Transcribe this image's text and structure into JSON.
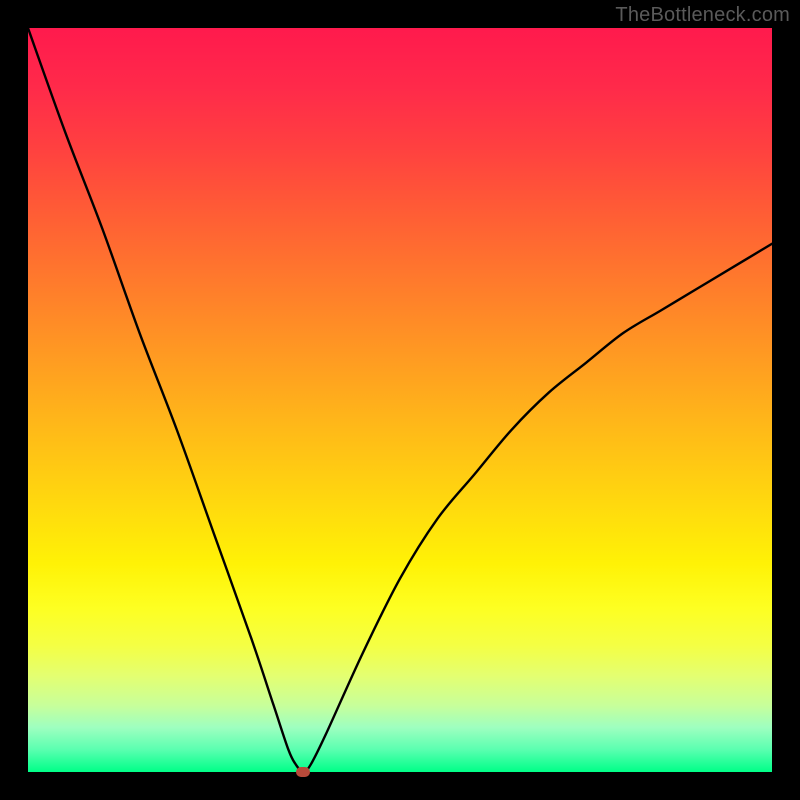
{
  "watermark": "TheBottleneck.com",
  "chart_data": {
    "type": "line",
    "title": "",
    "xlabel": "",
    "ylabel": "",
    "xlim": [
      0,
      100
    ],
    "ylim": [
      0,
      100
    ],
    "grid": false,
    "series": [
      {
        "name": "bottleneck-curve",
        "x": [
          0,
          5,
          10,
          15,
          20,
          25,
          30,
          33,
          35,
          36,
          37,
          38,
          40,
          45,
          50,
          55,
          60,
          65,
          70,
          75,
          80,
          85,
          90,
          95,
          100
        ],
        "values": [
          100,
          86,
          73,
          59,
          46,
          32,
          18,
          9,
          3,
          1,
          0,
          1,
          5,
          16,
          26,
          34,
          40,
          46,
          51,
          55,
          59,
          62,
          65,
          68,
          71
        ]
      }
    ],
    "marker": {
      "x": 37,
      "y": 0,
      "color": "#b84a3a"
    },
    "background_gradient": {
      "top": "#ff1a4d",
      "mid": "#ffd400",
      "bottom": "#00ff88"
    }
  }
}
